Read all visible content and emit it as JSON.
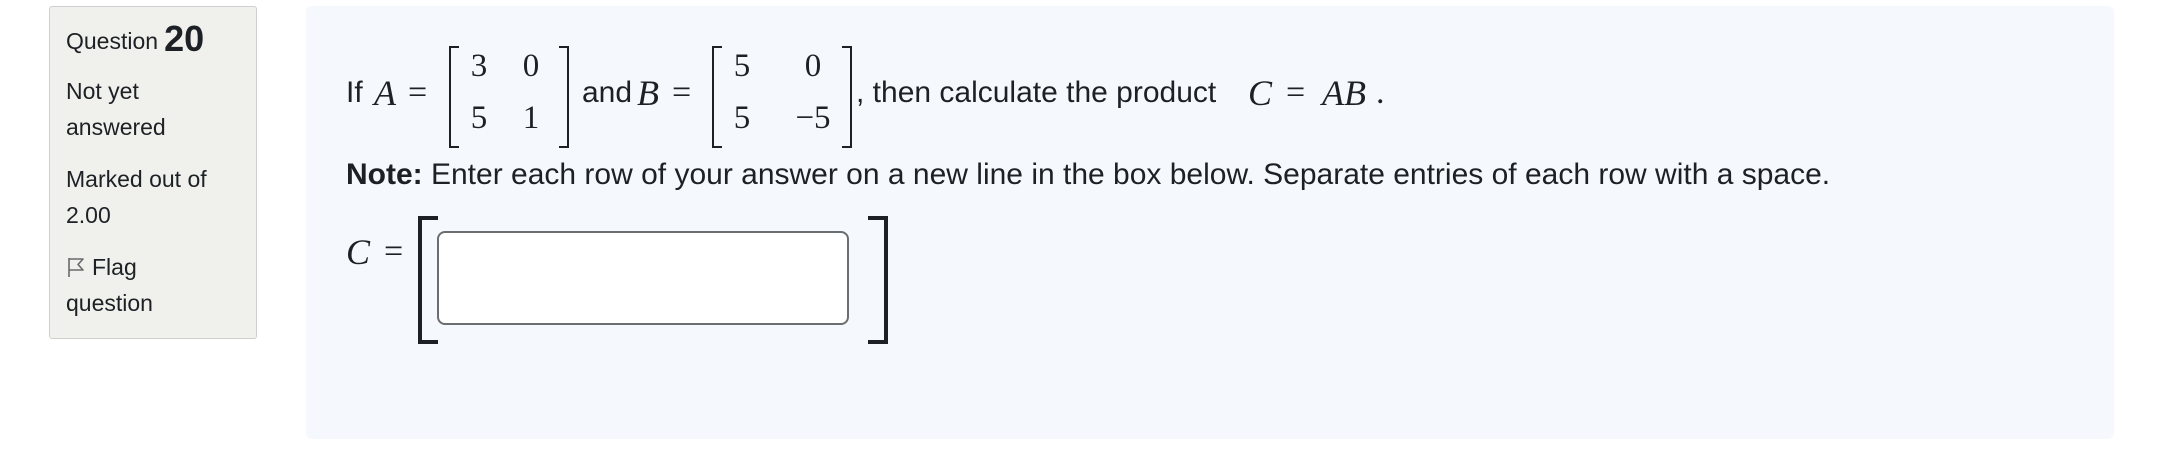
{
  "info": {
    "question_word": "Question",
    "question_number": "20",
    "state": "Not yet answered",
    "grade": "Marked out of 2.00",
    "flag_label": "Flag question"
  },
  "question": {
    "prefix": "If",
    "var_a": "A",
    "equals": "=",
    "matrix_a": [
      [
        "3",
        "0"
      ],
      [
        "5",
        "1"
      ]
    ],
    "and_text": "and",
    "var_b": "B",
    "matrix_b": [
      [
        "5",
        "0"
      ],
      [
        "5",
        "−5"
      ]
    ],
    "then_text": ", then calculate the product",
    "var_c": "C",
    "product": "AB",
    "period": "."
  },
  "note": {
    "label": "Note:",
    "text": " Enter each row of your answer on a new line in the box below. Separate entries of each row with a space."
  },
  "answer": {
    "var": "C",
    "equals": "=",
    "value": ""
  }
}
